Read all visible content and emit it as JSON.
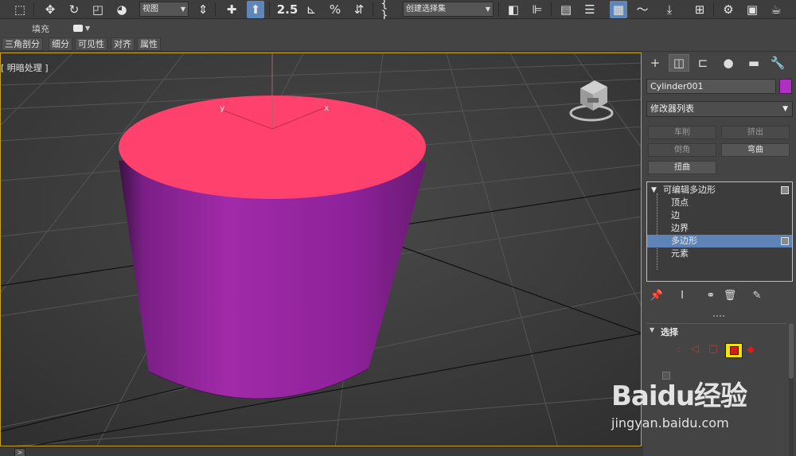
{
  "toolbar": {
    "viewport_combo": "视图",
    "selection_set_combo": "创建选择集",
    "snap_label": "2.5"
  },
  "ribbon": {
    "fill_label": "填充"
  },
  "tabs": [
    "三角剖分",
    "细分",
    "可见性",
    "对齐",
    "属性"
  ],
  "viewport": {
    "label": "[ 明暗处理 ]",
    "gizmo_x": "x",
    "gizmo_y": "y",
    "cylinder_top_color": "#ff416d",
    "cylinder_side_color": "#a12aa8"
  },
  "command_panel": {
    "object_name": "Cylinder001",
    "object_color": "#b02ec4",
    "modifier_list": "修改器列表",
    "modifier_buttons": [
      {
        "label": "车削",
        "enabled": false
      },
      {
        "label": "挤出",
        "enabled": false
      },
      {
        "label": "倒角",
        "enabled": false
      },
      {
        "label": "弯曲",
        "enabled": true
      },
      {
        "label": "扭曲",
        "enabled": true
      }
    ],
    "stack": {
      "root": "可编辑多边形",
      "items": [
        "顶点",
        "边",
        "边界",
        "多边形",
        "元素"
      ],
      "selected": "多边形"
    },
    "rollout": {
      "title": "选择"
    }
  },
  "statusbar": {
    "arrow": ">"
  },
  "watermark": {
    "brand": "Baidu经验",
    "url": "jingyan.baidu.com"
  }
}
